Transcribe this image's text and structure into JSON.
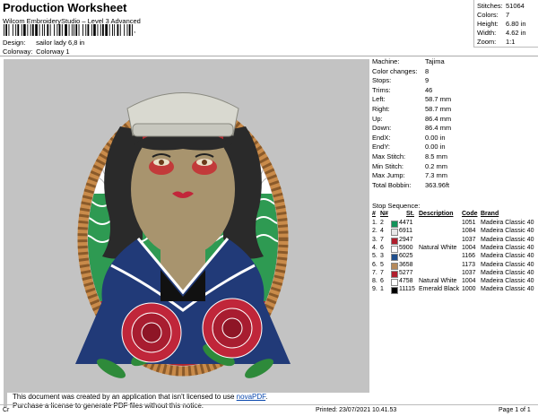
{
  "header": {
    "title": "Production Worksheet",
    "subtitle": "Wilcom EmbroideryStudio – Level 3 Advanced",
    "barcode_tail": ",",
    "design_label": "Design:",
    "design_value": "sailor lady 6,8 in",
    "colorway_label": "Colorway:",
    "colorway_value": "Colorway 1"
  },
  "stats": [
    {
      "label": "Stitches:",
      "value": "51064"
    },
    {
      "label": "Colors:",
      "value": "7"
    },
    {
      "label": "Height:",
      "value": "6.80 in"
    },
    {
      "label": "Width:",
      "value": "4.62 in"
    },
    {
      "label": "Zoom:",
      "value": "1:1"
    }
  ],
  "machine_info": [
    {
      "label": "Machine:",
      "value": "Tajima"
    },
    {
      "label": "Color changes:",
      "value": "8"
    },
    {
      "label": "Stops:",
      "value": "9"
    },
    {
      "label": "Trims:",
      "value": "46"
    },
    {
      "label": "Left:",
      "value": "58.7 mm"
    },
    {
      "label": "Right:",
      "value": "58.7 mm"
    },
    {
      "label": "Up:",
      "value": "86.4 mm"
    },
    {
      "label": "Down:",
      "value": "86.4 mm"
    },
    {
      "label": "EndX:",
      "value": "0.00 in"
    },
    {
      "label": "EndY:",
      "value": "0.00 in"
    },
    {
      "label": "Max Stitch:",
      "value": "8.5 mm"
    },
    {
      "label": "Min Stitch:",
      "value": "0.2 mm"
    },
    {
      "label": "Max Jump:",
      "value": "7.3 mm"
    },
    {
      "label": "Total Bobbin:",
      "value": "363.96ft"
    }
  ],
  "stop_sequence": {
    "title": "Stop Sequence:",
    "headers": [
      "#",
      "N#",
      "St.",
      "Description",
      "Code",
      "Brand"
    ],
    "rows": [
      {
        "stop": "1.",
        "needle": "2",
        "color": "#13925a",
        "st": "4471",
        "desc": "",
        "code": "1051",
        "brand": "Madeira Classic 40"
      },
      {
        "stop": "2.",
        "needle": "4",
        "color": "#e8e8e8",
        "st": "6911",
        "desc": "",
        "code": "1084",
        "brand": "Madeira Classic 40"
      },
      {
        "stop": "3.",
        "needle": "7",
        "color": "#b01e2d",
        "st": "2947",
        "desc": "",
        "code": "1037",
        "brand": "Madeira Classic 40"
      },
      {
        "stop": "4.",
        "needle": "6",
        "color": "#ffffff",
        "st": "5900",
        "desc": "Natural White",
        "code": "1004",
        "brand": "Madeira Classic 40"
      },
      {
        "stop": "5.",
        "needle": "3",
        "color": "#1f4e8c",
        "st": "6025",
        "desc": "",
        "code": "1166",
        "brand": "Madeira Classic 40"
      },
      {
        "stop": "6.",
        "needle": "5",
        "color": "#b5895a",
        "st": "3658",
        "desc": "",
        "code": "1173",
        "brand": "Madeira Classic 40"
      },
      {
        "stop": "7.",
        "needle": "7",
        "color": "#b01e2d",
        "st": "5277",
        "desc": "",
        "code": "1037",
        "brand": "Madeira Classic 40"
      },
      {
        "stop": "8.",
        "needle": "6",
        "color": "#ffffff",
        "st": "4758",
        "desc": "Natural White",
        "code": "1004",
        "brand": "Madeira Classic 40"
      },
      {
        "stop": "9.",
        "needle": "1",
        "color": "#000000",
        "st": "11115",
        "desc": "Emerald Black",
        "code": "1000",
        "brand": "Madeira Classic 40"
      }
    ]
  },
  "notice": {
    "line1_text": "This document was created by an application that isn't licensed to use ",
    "link": "novaPDF",
    "line1_end": ".",
    "line2": "Purchase a license to generate PDF files without this notice."
  },
  "footer": {
    "left": "Cr",
    "printed": "Printed: 23/07/2021 10.41.53",
    "page": "Page 1 of 1"
  }
}
